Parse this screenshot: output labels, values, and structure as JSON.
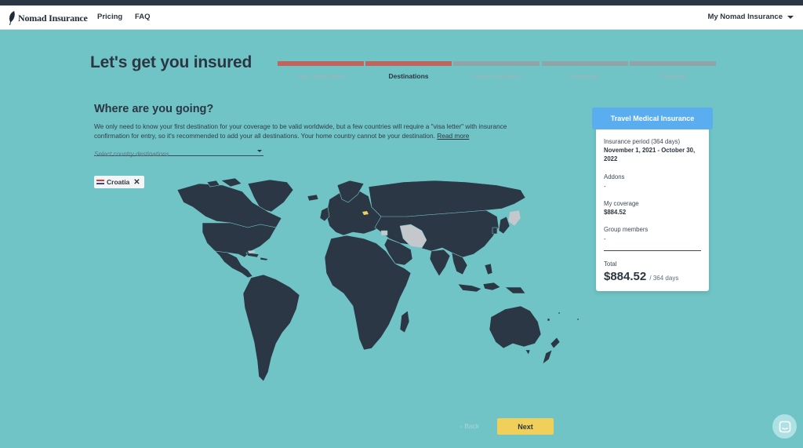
{
  "nav": {
    "brand": "Nomad Insurance",
    "links": [
      "Pricing",
      "FAQ"
    ],
    "account": "My Nomad Insurance"
  },
  "page": {
    "title": "Let's get you insured"
  },
  "steps": [
    {
      "label": "Your information",
      "state": "done"
    },
    {
      "label": "Destinations",
      "state": "active"
    },
    {
      "label": "Group members",
      "state": "upcoming"
    },
    {
      "label": "Summary",
      "state": "upcoming"
    },
    {
      "label": "Payment",
      "state": "upcoming"
    }
  ],
  "destinations": {
    "heading": "Where are you going?",
    "description": "We only need to know your first destination for your coverage to be valid worldwide, but a few countries will require a \"visa letter\" with insurance confirmation for entry, so it's recommended to add your all destinations. Your home country cannot be your destination.",
    "read_more": "Read more",
    "select_placeholder": "Select country destinations",
    "selected": [
      {
        "name": "Croatia",
        "remove": "✕"
      }
    ]
  },
  "summary": {
    "title": "Travel Medical Insurance",
    "period_label": "Insurance period (364 days)",
    "period_value": "November 1, 2021 - October 30, 2022",
    "addons_label": "Addons",
    "addons_value": "-",
    "coverage_label": "My coverage",
    "coverage_value": "$884.52",
    "group_label": "Group members",
    "group_value": "-",
    "total_label": "Total",
    "total_value": "$884.52",
    "total_suffix": "/ 364 days"
  },
  "footer": {
    "back": "‹ Back",
    "next": "Next"
  },
  "colors": {
    "background": "#70c4c6",
    "step_done": "#c0655d",
    "step_pending": "#8fa5a8",
    "card_header": "#5aaef0",
    "next_button": "#f0d05a",
    "map_land": "#2b3744",
    "map_unavailable": "#c4c8cc",
    "map_selected": "#f0d05a"
  },
  "icons": {
    "logo": "feather-icon",
    "account_menu": "chevron-down-icon",
    "chat": "chat-bubble-icon"
  }
}
